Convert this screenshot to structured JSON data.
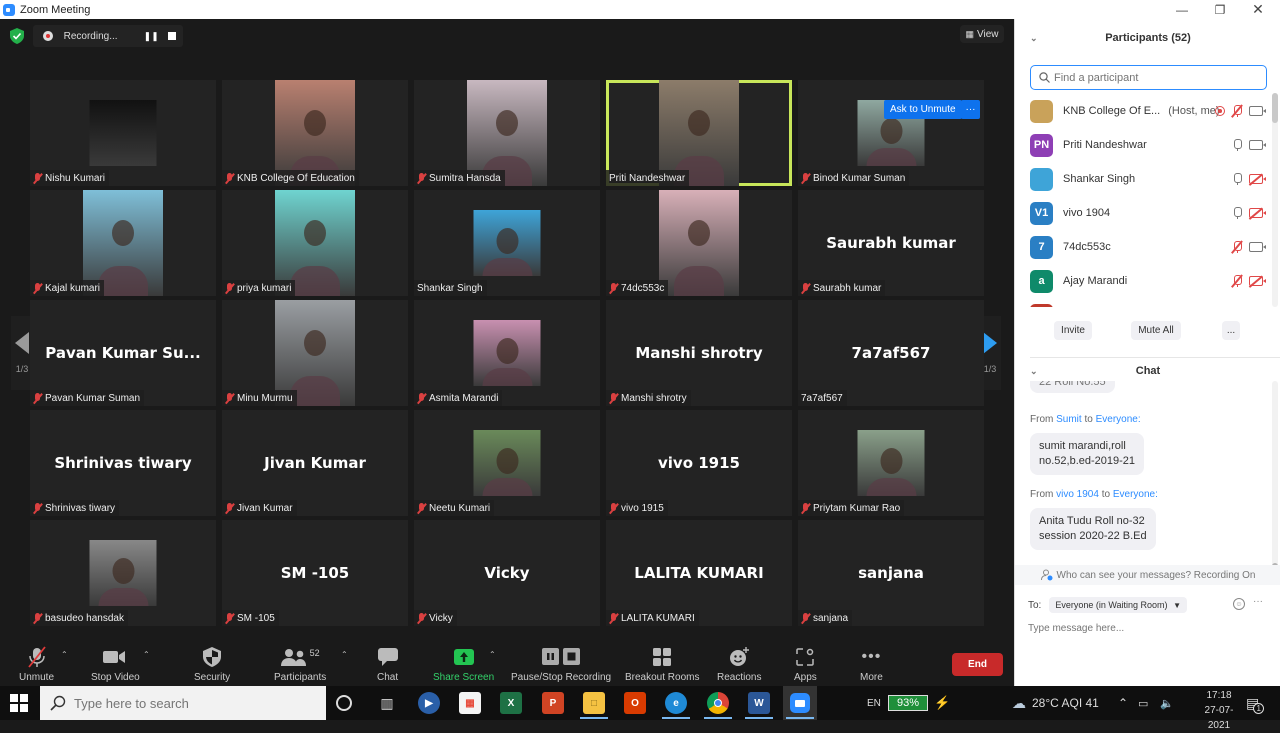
{
  "window": {
    "title": "Zoom Meeting",
    "controls": [
      "minimize",
      "maximize",
      "close"
    ]
  },
  "recording": {
    "status": "Recording...",
    "pause_icon": "pause-icon",
    "stop_icon": "stop-icon"
  },
  "view_button": {
    "label": "View"
  },
  "ask_to_unmute": {
    "label": "Ask to Unmute",
    "more": "···"
  },
  "pagination": {
    "left": "1/3",
    "right": "1/3"
  },
  "tiles": [
    {
      "name": "Nishu Kumari",
      "type": "photo",
      "muted": true,
      "photo_color": "#111"
    },
    {
      "name": "KNB College Of Education",
      "type": "video",
      "muted": true,
      "photo_color": "#b98070"
    },
    {
      "name": "Sumitra Hansda",
      "type": "video",
      "muted": true,
      "photo_color": "#c8b8c0"
    },
    {
      "name": "Priti Nandeshwar",
      "type": "video",
      "muted": false,
      "active": true,
      "photo_color": "#8c7c6a"
    },
    {
      "name": "Binod Kumar Suman",
      "type": "photo",
      "muted": true,
      "photo_color": "#8fa8a0"
    },
    {
      "name": "Kajal kumari",
      "type": "video",
      "muted": true,
      "photo_color": "#7fbfd8"
    },
    {
      "name": "priya kumari",
      "type": "video",
      "muted": true,
      "photo_color": "#6fd4d0"
    },
    {
      "name": "Shankar Singh",
      "type": "photo",
      "muted": false,
      "photo_color": "#3ea4d8"
    },
    {
      "name": "74dc553c",
      "type": "video",
      "muted": true,
      "photo_color": "#d8b0b8"
    },
    {
      "name": "Saurabh kumar",
      "type": "name",
      "muted": true,
      "display": "Saurabh kumar"
    },
    {
      "name": "Pavan Kumar Suman",
      "type": "name",
      "muted": true,
      "display": "Pavan Kumar Su..."
    },
    {
      "name": "Minu Murmu",
      "type": "video",
      "muted": true,
      "photo_color": "#9a9ea2"
    },
    {
      "name": "Asmita Marandi",
      "type": "photo",
      "muted": true,
      "photo_color": "#c890b0"
    },
    {
      "name": "Manshi shrotry",
      "type": "name",
      "muted": true,
      "display": "Manshi shrotry"
    },
    {
      "name": "7a7af567",
      "type": "name",
      "muted": false,
      "display": "7a7af567"
    },
    {
      "name": "Shrinivas tiwary",
      "type": "name",
      "muted": true,
      "display": "Shrinivas tiwary"
    },
    {
      "name": "Jivan Kumar",
      "type": "name",
      "muted": true,
      "display": "Jivan Kumar"
    },
    {
      "name": "Neetu Kumari",
      "type": "photo",
      "muted": true,
      "photo_color": "#6a8a5a"
    },
    {
      "name": "vivo 1915",
      "type": "name",
      "muted": true,
      "display": "vivo 1915"
    },
    {
      "name": "Priytam Kumar Rao",
      "type": "photo",
      "muted": true,
      "photo_color": "#8aa08a"
    },
    {
      "name": "basudeo hansdak",
      "type": "photo",
      "muted": true,
      "photo_color": "#888"
    },
    {
      "name": "SM -105",
      "type": "name",
      "muted": true,
      "display": "SM -105"
    },
    {
      "name": "Vicky",
      "type": "name",
      "muted": true,
      "display": "Vicky"
    },
    {
      "name": "LALITA KUMARI",
      "type": "name",
      "muted": true,
      "display": "LALITA KUMARI"
    },
    {
      "name": "sanjana",
      "type": "name",
      "muted": true,
      "display": "sanjana"
    }
  ],
  "toolbar": {
    "unmute": "Unmute",
    "stop_video": "Stop Video",
    "security": "Security",
    "participants": "Participants",
    "participants_count": "52",
    "chat": "Chat",
    "share_screen": "Share Screen",
    "pause_stop_recording": "Pause/Stop Recording",
    "breakout_rooms": "Breakout Rooms",
    "reactions": "Reactions",
    "apps": "Apps",
    "more": "More",
    "end": "End"
  },
  "participants_panel": {
    "title": "Participants (52)",
    "search_placeholder": "Find a participant",
    "list": [
      {
        "name": "KNB College Of E...",
        "tag": "(Host, me)",
        "avatar": "",
        "avatar_color": "#c9a25a",
        "mic": "off",
        "cam": "on",
        "recording": true
      },
      {
        "name": "Priti Nandeshwar",
        "tag": "",
        "avatar": "PN",
        "avatar_color": "#8e3fb5",
        "mic": "on",
        "cam": "on",
        "recording": false
      },
      {
        "name": "Shankar Singh",
        "tag": "",
        "avatar": "",
        "avatar_color": "#3ea4d8",
        "mic": "on",
        "cam": "off",
        "recording": false
      },
      {
        "name": "vivo 1904",
        "tag": "",
        "avatar": "V1",
        "avatar_color": "#2a7fc4",
        "mic": "on",
        "cam": "off",
        "recording": false
      },
      {
        "name": "74dc553c",
        "tag": "",
        "avatar": "7",
        "avatar_color": "#2a7fc4",
        "mic": "off",
        "cam": "on",
        "recording": false
      },
      {
        "name": "Ajay Marandi",
        "tag": "",
        "avatar": "a",
        "avatar_color": "#0f8a6a",
        "mic": "off",
        "cam": "off",
        "recording": false
      },
      {
        "name": "",
        "tag": "",
        "avatar": "",
        "avatar_color": "#c0392b",
        "mic": "",
        "cam": "",
        "recording": false
      }
    ],
    "invite": "Invite",
    "mute_all": "Mute All",
    "more": "..."
  },
  "chat_panel": {
    "title": "Chat",
    "partial_message": "22 Roll No.55",
    "messages": [
      {
        "from_prefix": "From",
        "from": "Sumit",
        "to_prefix": "to",
        "to": "Everyone:",
        "lines": [
          "sumit marandi,roll",
          "no.52,b.ed-2019-21"
        ]
      },
      {
        "from_prefix": "From",
        "from": "vivo 1904",
        "to_prefix": "to",
        "to": "Everyone:",
        "lines": [
          "Anita Tudu Roll no-32",
          "session 2020-22 B.Ed"
        ]
      }
    ],
    "visibility_notice": "Who can see your messages? Recording On",
    "to_label": "To:",
    "recipient": "Everyone (in Waiting Room)",
    "input_placeholder": "Type message here..."
  },
  "taskbar": {
    "search_placeholder": "Type here to search",
    "language": "EN",
    "battery": "93%",
    "weather": "28°C  AQI 41",
    "time": "17:18",
    "date": "27-07-2021",
    "notifications": "1"
  }
}
